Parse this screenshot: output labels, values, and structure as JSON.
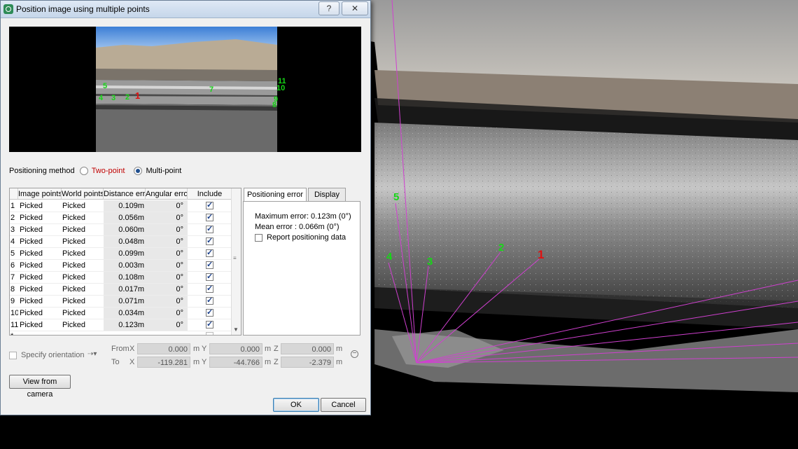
{
  "window": {
    "title": "Position image using multiple points",
    "help_label": "?",
    "close_label": "✕"
  },
  "preview": {
    "point_labels": [
      "11",
      "10",
      "5",
      "4",
      "3",
      "2",
      "1",
      "9",
      "8",
      "7"
    ]
  },
  "positioning_method": {
    "label": "Positioning method",
    "options": [
      "Two-point",
      "Multi-point"
    ],
    "selected": "Multi-point"
  },
  "table": {
    "columns": [
      "Image points",
      "World points",
      "Distance error",
      "Angular error",
      "Include"
    ],
    "rows": [
      {
        "n": "1",
        "image": "Picked",
        "world": "Picked",
        "dist": "0.109m",
        "ang": "0°",
        "include": true
      },
      {
        "n": "2",
        "image": "Picked",
        "world": "Picked",
        "dist": "0.056m",
        "ang": "0°",
        "include": true
      },
      {
        "n": "3",
        "image": "Picked",
        "world": "Picked",
        "dist": "0.060m",
        "ang": "0°",
        "include": true
      },
      {
        "n": "4",
        "image": "Picked",
        "world": "Picked",
        "dist": "0.048m",
        "ang": "0°",
        "include": true
      },
      {
        "n": "5",
        "image": "Picked",
        "world": "Picked",
        "dist": "0.099m",
        "ang": "0°",
        "include": true
      },
      {
        "n": "6",
        "image": "Picked",
        "world": "Picked",
        "dist": "0.003m",
        "ang": "0°",
        "include": true
      },
      {
        "n": "7",
        "image": "Picked",
        "world": "Picked",
        "dist": "0.108m",
        "ang": "0°",
        "include": true
      },
      {
        "n": "8",
        "image": "Picked",
        "world": "Picked",
        "dist": "0.017m",
        "ang": "0°",
        "include": true
      },
      {
        "n": "9",
        "image": "Picked",
        "world": "Picked",
        "dist": "0.071m",
        "ang": "0°",
        "include": true
      },
      {
        "n": "10",
        "image": "Picked",
        "world": "Picked",
        "dist": "0.034m",
        "ang": "0°",
        "include": true
      },
      {
        "n": "11",
        "image": "Picked",
        "world": "Picked",
        "dist": "0.123m",
        "ang": "0°",
        "include": true
      }
    ],
    "new_row_marker": "*"
  },
  "tabs": {
    "items": [
      "Positioning error",
      "Display"
    ],
    "active": "Positioning error"
  },
  "error_panel": {
    "max_error": "Maximum error:  0.123m (0°)",
    "mean_error": "Mean error :  0.066m (0°)",
    "report_label": "Report positioning data"
  },
  "orientation": {
    "specify_label": "Specify orientation",
    "from_label": "From",
    "to_label": "To",
    "axis_x": "X",
    "axis_y": "Y",
    "axis_z": "Z",
    "unit": "m",
    "from": {
      "x": "0.000",
      "y": "0.000",
      "z": "0.000"
    },
    "to": {
      "x": "-119.281",
      "y": "-44.766",
      "z": "-2.379"
    }
  },
  "buttons": {
    "view_from_camera": "View from camera",
    "ok": "OK",
    "cancel": "Cancel"
  },
  "viewport": {
    "labels": [
      "5",
      "4",
      "3",
      "2",
      "1"
    ]
  },
  "colors": {
    "point_green": "#16d616",
    "point_red": "#e01010",
    "ray_magenta": "#d040d0",
    "two_point_red": "#c00000"
  }
}
